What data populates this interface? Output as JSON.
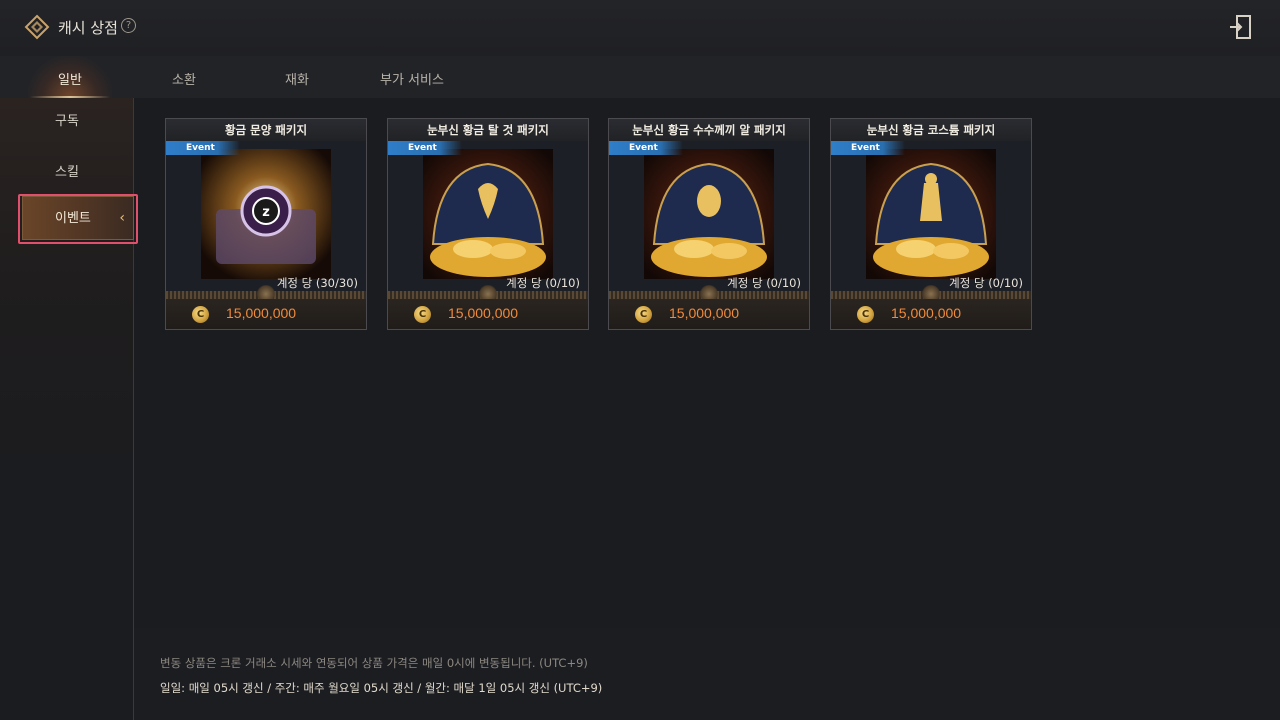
{
  "header": {
    "title": "캐시 상점",
    "help_icon": "question-circle-icon",
    "exit_icon": "exit-door-icon"
  },
  "tabs": [
    {
      "label": "일반",
      "active": true
    },
    {
      "label": "소환",
      "active": false
    },
    {
      "label": "재화",
      "active": false
    },
    {
      "label": "부가 서비스",
      "active": false
    }
  ],
  "sidebar": {
    "items": [
      {
        "label": "구독",
        "selected": false
      },
      {
        "label": "스킬",
        "selected": false
      },
      {
        "label": "이벤트",
        "selected": true
      }
    ]
  },
  "products": [
    {
      "title": "황금 문양 패키지",
      "badge": "Event",
      "limit": "계정 당 (30/30)",
      "price": "15,000,000",
      "art": "purple-emblem-gold-chest"
    },
    {
      "title": "눈부신 황금 탈 것 패키지",
      "badge": "Event",
      "limit": "계정 당 (0/10)",
      "price": "15,000,000",
      "art": "gold-coins-dragon-fan"
    },
    {
      "title": "눈부신 황금 수수께끼 알 패키지",
      "badge": "Event",
      "limit": "계정 당 (0/10)",
      "price": "15,000,000",
      "art": "gold-coins-egg-fan"
    },
    {
      "title": "눈부신 황금 코스튬 패키지",
      "badge": "Event",
      "limit": "계정 당 (0/10)",
      "price": "15,000,000",
      "art": "gold-coins-costume-fan"
    }
  ],
  "currency_icon": "coin-c-icon",
  "coin_letter": "C",
  "notes": {
    "line1": "변동 상품은 크론 거래소 시세와 연동되어 상품 가격은 매일 0시에 변동됩니다. (UTC+9)",
    "line2": "일일: 매일 05시 갱신 / 주간: 매주 월요일 05시 갱신 / 월간: 매달 1일 05시 갱신 (UTC+9)"
  },
  "colors": {
    "price": "#f08a3c",
    "event_badge": "#2f7ec9",
    "highlight_box": "#e0506a",
    "background": "#1b1c1f"
  }
}
